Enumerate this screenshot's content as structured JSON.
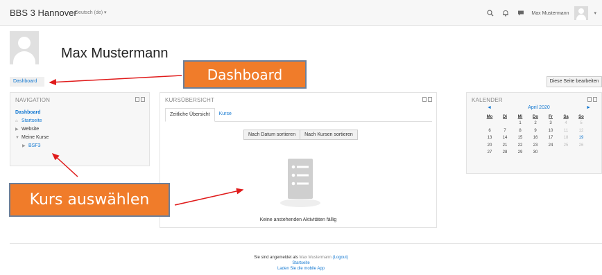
{
  "topbar": {
    "site_name": "BBS 3 Hannover",
    "language": "Deutsch (de) ▾",
    "user_name": "Max Mustermann",
    "icons": [
      "search-icon",
      "bell-icon",
      "message-icon",
      "avatar-icon",
      "chevron-down-icon"
    ]
  },
  "profile": {
    "name": "Max Mustermann"
  },
  "breadcrumb": {
    "current": "Dashboard"
  },
  "page_actions": {
    "edit_label": "Diese Seite bearbeiten"
  },
  "navigation": {
    "title": "NAVIGATION",
    "items": [
      {
        "label": "Dashboard",
        "style": "bold"
      },
      {
        "label": "Startseite",
        "icon": "home-icon"
      },
      {
        "label": "Website",
        "icon": "chevron-right-icon"
      },
      {
        "label": "Meine Kurse",
        "icon": "chevron-down-icon"
      },
      {
        "label": "BSF3",
        "icon": "chevron-right-icon"
      }
    ]
  },
  "course_overview": {
    "title": "KURSÜBERSICHT",
    "tabs": [
      {
        "label": "Zeitliche Übersicht",
        "active": true
      },
      {
        "label": "Kurse",
        "active": false
      }
    ],
    "sort_buttons": [
      "Nach Datum sortieren",
      "Nach Kursen sortieren"
    ],
    "empty_message": "Keine anstehenden Aktivitäten fällig"
  },
  "calendar": {
    "title": "KALENDER",
    "month": "April 2020",
    "prev": "◄",
    "next": "►",
    "weekdays": [
      "Mo",
      "Di",
      "Mi",
      "Do",
      "Fr",
      "Sa",
      "So"
    ],
    "weeks": [
      [
        "",
        "",
        "1",
        "2",
        "3",
        "4",
        "5"
      ],
      [
        "6",
        "7",
        "8",
        "9",
        "10",
        "11",
        "12"
      ],
      [
        "13",
        "14",
        "15",
        "16",
        "17",
        "18",
        "19"
      ],
      [
        "20",
        "21",
        "22",
        "23",
        "24",
        "25",
        "26"
      ],
      [
        "27",
        "28",
        "29",
        "30",
        "",
        "",
        ""
      ]
    ],
    "today": "19"
  },
  "footer": {
    "logged_in_prefix": "Sie sind angemeldet als",
    "user": "Max Mustermann",
    "logout": "(Logout)",
    "home": "Startseite",
    "mobile_app": "Laden Sie die mobile App"
  },
  "annotations": {
    "dashboard_callout": "Dashboard",
    "course_callout": "Kurs auswählen",
    "accent_color": "#f07c2a",
    "arrow_color": "#e01b1b"
  },
  "colors": {
    "link": "#1177d1",
    "block_bg": "#f7f7f7"
  }
}
